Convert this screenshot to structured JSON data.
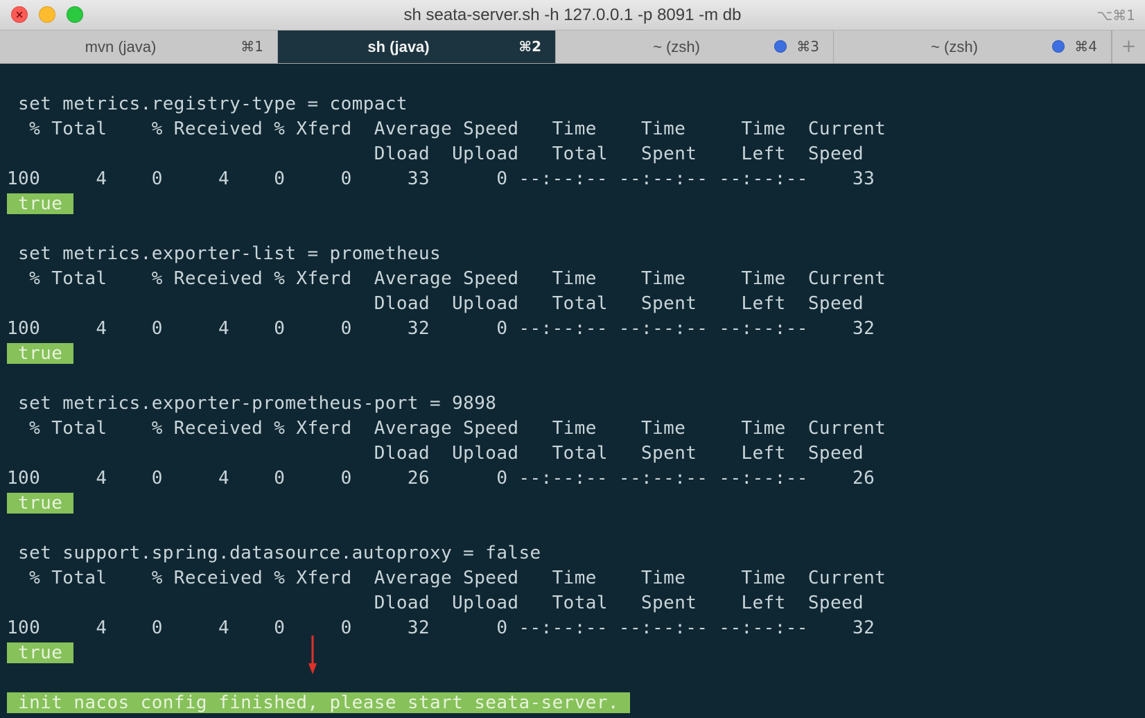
{
  "window": {
    "title": "sh seata-server.sh -h 127.0.0.1 -p 8091 -m db",
    "shortcut": "⌥⌘1"
  },
  "tabs": [
    {
      "label": "mvn (java)",
      "shortcut": "⌘1",
      "active": false,
      "indicator": false
    },
    {
      "label": "sh (java)",
      "shortcut": "⌘2",
      "active": true,
      "indicator": false
    },
    {
      "label": "~ (zsh)",
      "shortcut": "⌘3",
      "active": false,
      "indicator": true
    },
    {
      "label": "~ (zsh)",
      "shortcut": "⌘4",
      "active": false,
      "indicator": true
    }
  ],
  "new_tab_label": "+",
  "blocks": [
    {
      "command": " set metrics.registry-type = compact",
      "header1": "  % Total    % Received % Xferd  Average Speed   Time    Time     Time  Current",
      "header2": "                                 Dload  Upload   Total   Spent    Left  Speed",
      "progress": "100     4    0     4    0     0     33      0 --:--:-- --:--:-- --:--:--    33",
      "result": " true "
    },
    {
      "command": " set metrics.exporter-list = prometheus",
      "header1": "  % Total    % Received % Xferd  Average Speed   Time    Time     Time  Current",
      "header2": "                                 Dload  Upload   Total   Spent    Left  Speed",
      "progress": "100     4    0     4    0     0     32      0 --:--:-- --:--:-- --:--:--    32",
      "result": " true "
    },
    {
      "command": " set metrics.exporter-prometheus-port = 9898",
      "header1": "  % Total    % Received % Xferd  Average Speed   Time    Time     Time  Current",
      "header2": "                                 Dload  Upload   Total   Spent    Left  Speed",
      "progress": "100     4    0     4    0     0     26      0 --:--:-- --:--:-- --:--:--    26",
      "result": " true "
    },
    {
      "command": " set support.spring.datasource.autoproxy = false",
      "header1": "  % Total    % Received % Xferd  Average Speed   Time    Time     Time  Current",
      "header2": "                                 Dload  Upload   Total   Spent    Left  Speed",
      "progress": "100     4    0     4    0     0     32      0 --:--:-- --:--:-- --:--:--    32",
      "result": " true "
    }
  ],
  "final_message": " init nacos config finished, please start seata-server. ",
  "colors": {
    "background": "#0f2733",
    "text": "#c9d5d9",
    "highlight": "#86c15a",
    "arrow": "#e0302a",
    "tab_indicator": "#3e6fe0"
  },
  "icons": {
    "close": "close-icon",
    "minimize": "minimize-icon",
    "maximize": "maximize-icon",
    "annotation": "arrow-down-icon"
  }
}
